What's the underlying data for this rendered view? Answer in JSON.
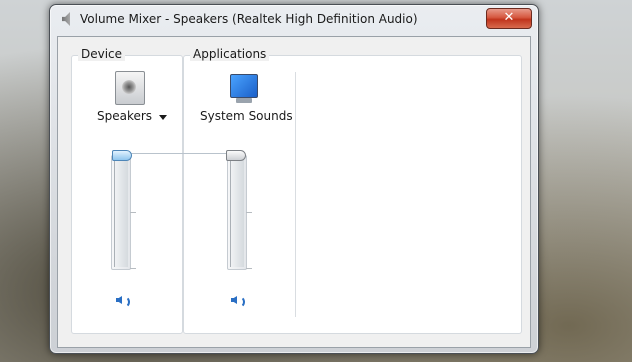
{
  "window": {
    "title": "Volume Mixer - Speakers (Realtek High Definition Audio)",
    "close_symbol": "✕"
  },
  "device": {
    "group_label": "Device",
    "name": "Speakers",
    "icon": "speaker-icon",
    "volume_fraction": 1.0
  },
  "applications": {
    "group_label": "Applications",
    "items": [
      {
        "name": "System Sounds",
        "icon": "monitor-icon",
        "volume_fraction": 1.0
      }
    ]
  },
  "colors": {
    "accent": "#2a6fc4",
    "close_red": "#c0341c"
  }
}
